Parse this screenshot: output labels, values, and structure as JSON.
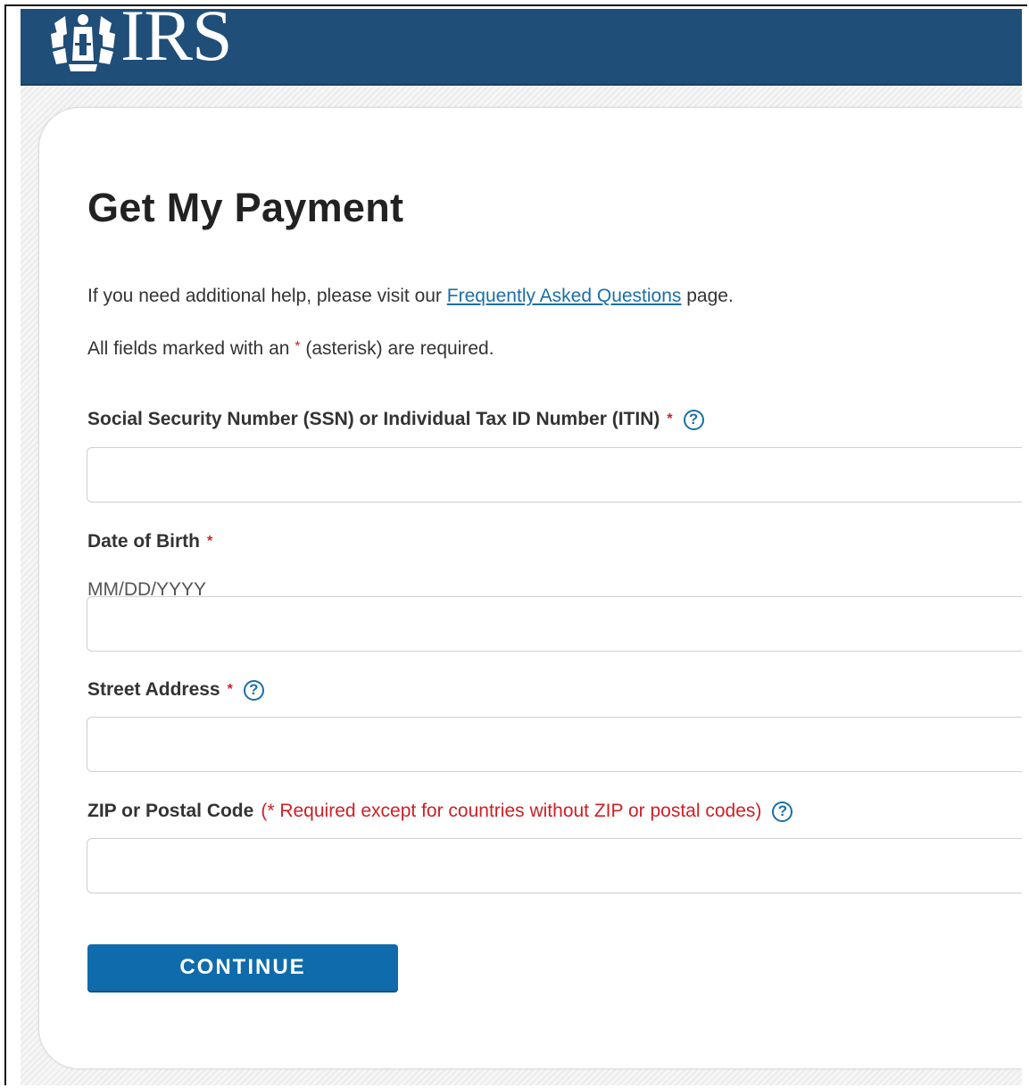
{
  "header": {
    "logo_text": "IRS",
    "colors": {
      "background": "#1f4e79"
    }
  },
  "page": {
    "title": "Get My Payment",
    "help": {
      "prefix": "If you need additional help, please visit our ",
      "link_text": "Frequently Asked Questions",
      "suffix": " page."
    },
    "required_note": {
      "prefix": "All fields marked with an ",
      "asterisk": "*",
      "suffix": " (asterisk) are required."
    }
  },
  "form": {
    "ssn": {
      "label": "Social Security Number (SSN) or Individual Tax ID Number (ITIN)",
      "required_mark": "*",
      "help_icon": "?",
      "value": ""
    },
    "dob": {
      "label": "Date of Birth",
      "required_mark": "*",
      "hint": "MM/DD/YYYY",
      "value": ""
    },
    "street": {
      "label": "Street Address",
      "required_mark": "*",
      "help_icon": "?",
      "value": ""
    },
    "zip": {
      "label": "ZIP or Postal Code",
      "note": "(* Required except for countries without ZIP or postal codes)",
      "help_icon": "?",
      "value": ""
    },
    "continue_label": "CONTINUE"
  },
  "colors": {
    "required": "#cd2026",
    "link": "#1a6fa8",
    "button": "#0f6bab"
  }
}
